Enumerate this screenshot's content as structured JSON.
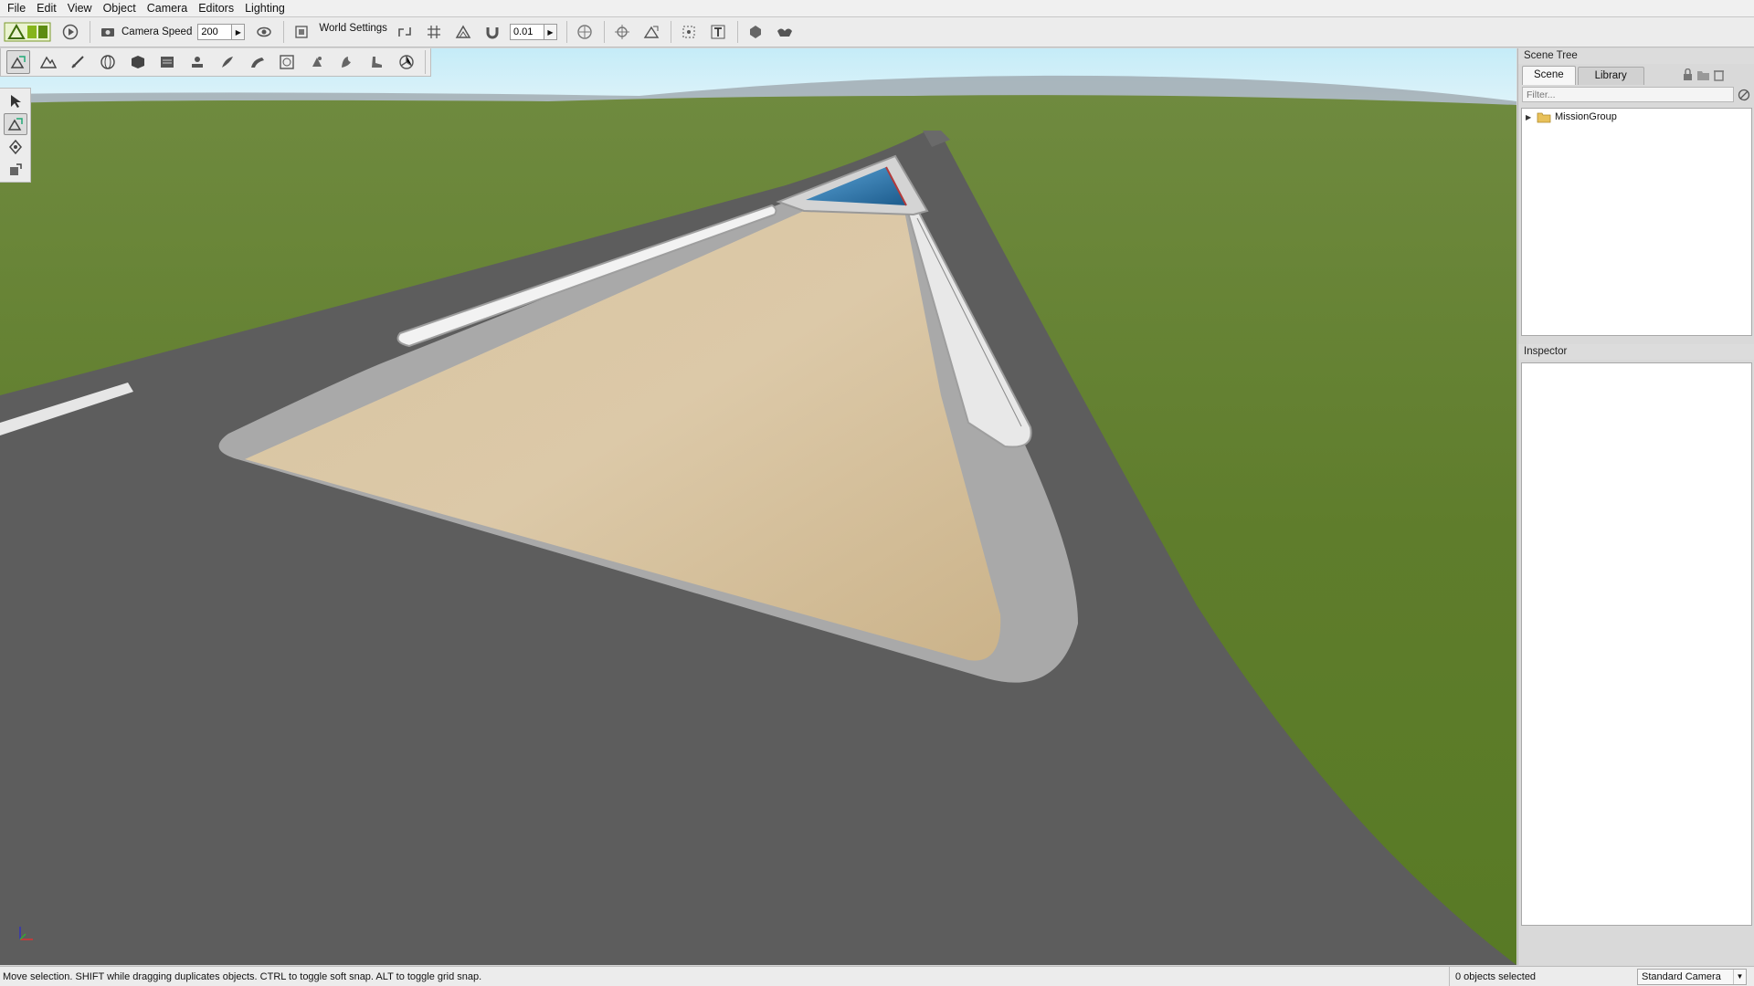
{
  "menu": [
    "File",
    "Edit",
    "View",
    "Object",
    "Camera",
    "Editors",
    "Lighting"
  ],
  "toolbar": {
    "camera_speed_label": "Camera Speed",
    "camera_speed_value": "200",
    "world_settings_label": "World Settings",
    "snap_value": "0.01"
  },
  "scene_tree": {
    "title": "Scene Tree",
    "tabs": [
      "Scene",
      "Library"
    ],
    "filter_placeholder": "Filter...",
    "items": [
      {
        "label": "MissionGroup"
      }
    ]
  },
  "inspector": {
    "title": "Inspector"
  },
  "status": {
    "message": "Move selection.  SHIFT while dragging duplicates objects.  CTRL to toggle soft snap.  ALT to toggle grid snap.",
    "selection_count": "0 objects selected",
    "camera_mode": "Standard Camera"
  },
  "colors": {
    "sky": "#b8e6f5",
    "grass": "#62802f",
    "asphalt": "#5c5c5c",
    "sand": "#d6c3a1",
    "curb": "#a5a5a5",
    "water": "#2a6d9c"
  }
}
